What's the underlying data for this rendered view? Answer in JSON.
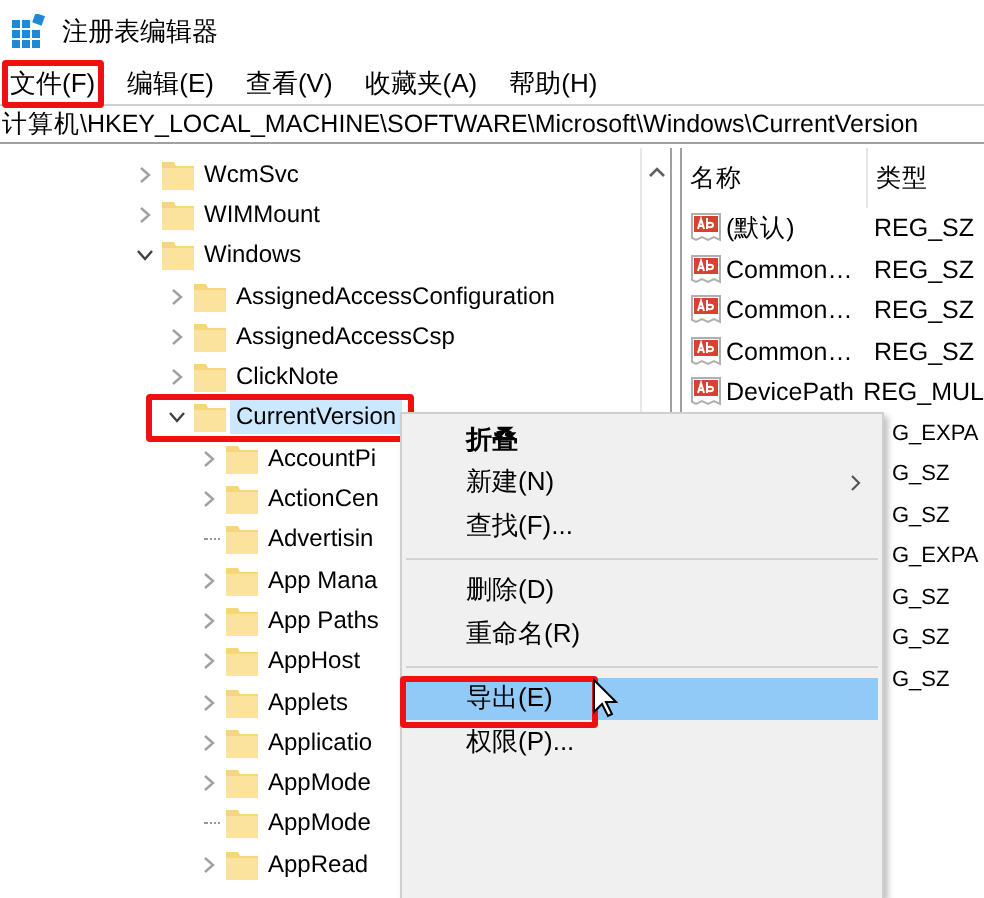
{
  "window": {
    "title": "注册表编辑器"
  },
  "menu_bar": [
    {
      "label": "文件(F)",
      "highlighted": true
    },
    {
      "label": "编辑(E)",
      "highlighted": false
    },
    {
      "label": "查看(V)",
      "highlighted": false
    },
    {
      "label": "收藏夹(A)",
      "highlighted": false
    },
    {
      "label": "帮助(H)",
      "highlighted": false
    }
  ],
  "address": "计算机\\HKEY_LOCAL_MACHINE\\SOFTWARE\\Microsoft\\Windows\\CurrentVersion",
  "tree": [
    {
      "label": "WcmSvc",
      "expandable": true,
      "expanded": false,
      "selected": false,
      "highlighted": false
    },
    {
      "label": "WIMMount",
      "expandable": true,
      "expanded": false,
      "selected": false,
      "highlighted": false
    },
    {
      "label": "Windows",
      "expandable": true,
      "expanded": true,
      "selected": false,
      "highlighted": false,
      "children": [
        {
          "label": "AssignedAccessConfiguration",
          "expandable": true,
          "expanded": false,
          "selected": false,
          "highlighted": false
        },
        {
          "label": "AssignedAccessCsp",
          "expandable": true,
          "expanded": false,
          "selected": false,
          "highlighted": false
        },
        {
          "label": "ClickNote",
          "expandable": true,
          "expanded": false,
          "selected": false,
          "highlighted": false
        },
        {
          "label": "CurrentVersion",
          "expandable": true,
          "expanded": true,
          "selected": true,
          "highlighted": true,
          "children": [
            {
              "label": "AccountPi",
              "expandable": true,
              "expanded": false,
              "selected": false,
              "highlighted": false
            },
            {
              "label": "ActionCen",
              "expandable": true,
              "expanded": false,
              "selected": false,
              "highlighted": false
            },
            {
              "label": "Advertisin",
              "expandable": false,
              "selected": false,
              "highlighted": false
            },
            {
              "label": "App Mana",
              "expandable": true,
              "expanded": false,
              "selected": false,
              "highlighted": false
            },
            {
              "label": "App Paths",
              "expandable": true,
              "expanded": false,
              "selected": false,
              "highlighted": false
            },
            {
              "label": "AppHost",
              "expandable": true,
              "expanded": false,
              "selected": false,
              "highlighted": false
            },
            {
              "label": "Applets",
              "expandable": true,
              "expanded": false,
              "selected": false,
              "highlighted": false
            },
            {
              "label": "Applicatio",
              "expandable": true,
              "expanded": false,
              "selected": false,
              "highlighted": false
            },
            {
              "label": "AppMode",
              "expandable": true,
              "expanded": false,
              "selected": false,
              "highlighted": false
            },
            {
              "label": "AppMode",
              "expandable": false,
              "selected": false,
              "highlighted": false
            },
            {
              "label": "AppRead",
              "expandable": true,
              "expanded": false,
              "selected": false,
              "highlighted": false
            }
          ]
        }
      ]
    }
  ],
  "values": {
    "columns": [
      "名称",
      "类型"
    ],
    "rows": [
      {
        "name": "(默认)",
        "type": "REG_SZ"
      },
      {
        "name": "Common…",
        "type": "REG_SZ"
      },
      {
        "name": "Common…",
        "type": "REG_SZ"
      },
      {
        "name": "Common…",
        "type": "REG_SZ"
      },
      {
        "name": "DevicePath",
        "type": "REG_MUL"
      },
      {
        "type": "G_EXPA"
      },
      {
        "type": "G_SZ"
      },
      {
        "type": "G_SZ"
      },
      {
        "type": "G_EXPA"
      },
      {
        "type": "G_SZ"
      },
      {
        "type": "G_SZ"
      },
      {
        "type": "G_SZ"
      }
    ]
  },
  "context_menu": [
    {
      "kind": "item",
      "label": "折叠",
      "bold": true,
      "submenu": false,
      "selected": false,
      "highlighted": false
    },
    {
      "kind": "item",
      "label": "新建(N)",
      "bold": false,
      "submenu": true,
      "selected": false,
      "highlighted": false
    },
    {
      "kind": "item",
      "label": "查找(F)...",
      "bold": false,
      "submenu": false,
      "selected": false,
      "highlighted": false
    },
    {
      "kind": "separator"
    },
    {
      "kind": "item",
      "label": "删除(D)",
      "bold": false,
      "submenu": false,
      "selected": false,
      "highlighted": false
    },
    {
      "kind": "item",
      "label": "重命名(R)",
      "bold": false,
      "submenu": false,
      "selected": false,
      "highlighted": false
    },
    {
      "kind": "separator"
    },
    {
      "kind": "item",
      "label": "导出(E)",
      "bold": false,
      "submenu": false,
      "selected": true,
      "highlighted": true
    },
    {
      "kind": "item",
      "label": "权限(P)...",
      "bold": false,
      "submenu": false,
      "selected": false,
      "highlighted": false
    }
  ]
}
